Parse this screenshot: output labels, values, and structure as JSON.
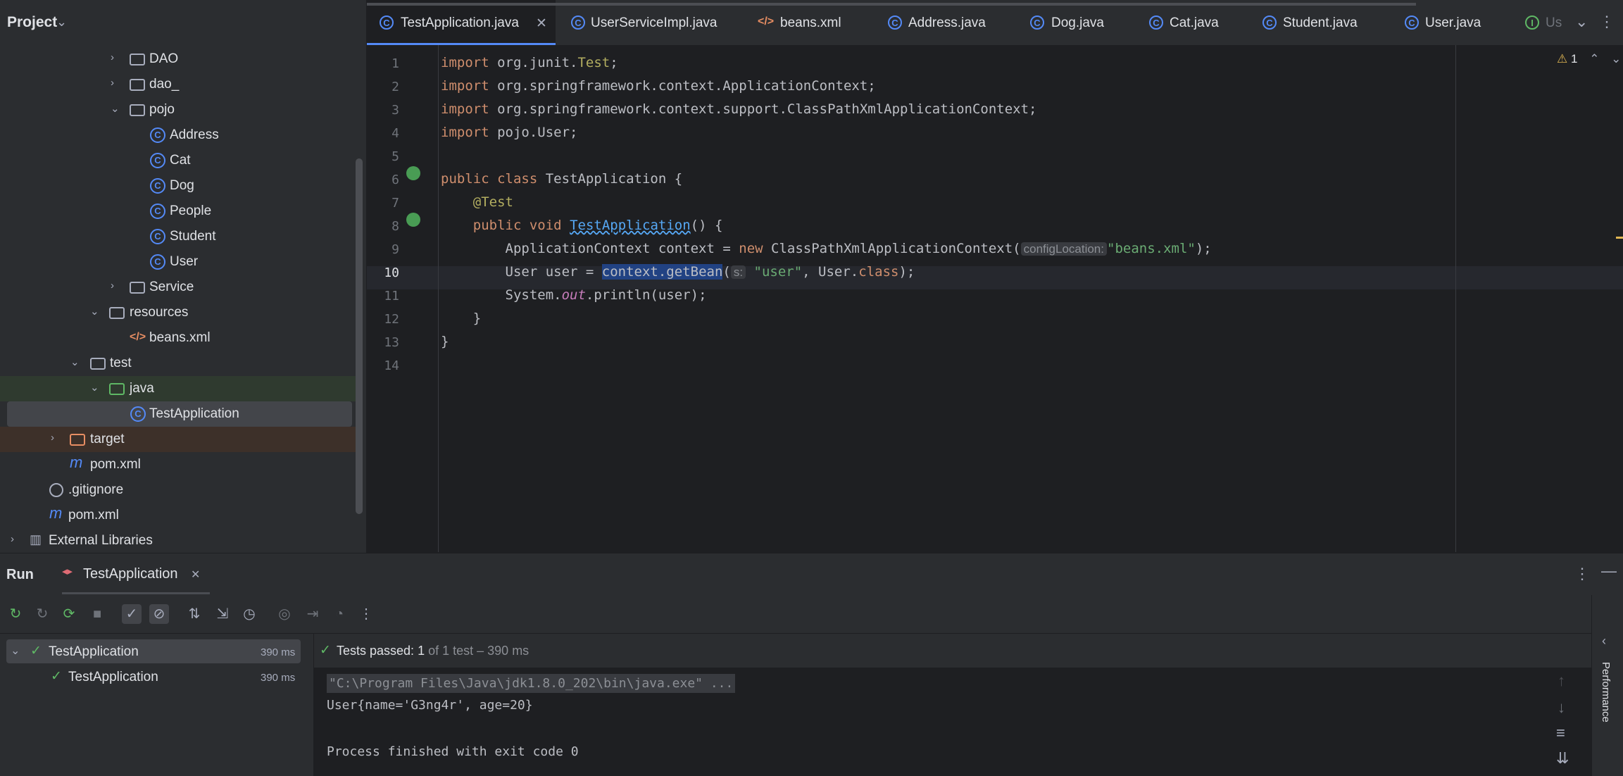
{
  "project": {
    "title": "Project",
    "tree": [
      {
        "label": "DAO",
        "kind": "folder",
        "arrow": "›"
      },
      {
        "label": "dao_",
        "kind": "folder",
        "arrow": "›"
      },
      {
        "label": "pojo",
        "kind": "folder",
        "arrow": "⌄"
      },
      {
        "label": "Address",
        "kind": "class"
      },
      {
        "label": "Cat",
        "kind": "class"
      },
      {
        "label": "Dog",
        "kind": "class"
      },
      {
        "label": "People",
        "kind": "class"
      },
      {
        "label": "Student",
        "kind": "class"
      },
      {
        "label": "User",
        "kind": "class"
      },
      {
        "label": "Service",
        "kind": "folder",
        "arrow": "›"
      },
      {
        "label": "resources",
        "kind": "folder",
        "arrow": "⌄"
      },
      {
        "label": "beans.xml",
        "kind": "xml"
      },
      {
        "label": "test",
        "kind": "folder",
        "arrow": "⌄"
      },
      {
        "label": "java",
        "kind": "folder",
        "arrow": "⌄"
      },
      {
        "label": "TestApplication",
        "kind": "class"
      },
      {
        "label": "target",
        "kind": "folder",
        "arrow": "›"
      },
      {
        "label": "pom.xml",
        "kind": "maven"
      },
      {
        "label": ".gitignore",
        "kind": "ignore"
      },
      {
        "label": "pom.xml",
        "kind": "maven"
      },
      {
        "label": "External Libraries",
        "kind": "lib",
        "arrow": "›"
      }
    ]
  },
  "tabs": [
    {
      "label": "TestApplication.java",
      "icon": "class-icon"
    },
    {
      "label": "UserServiceImpl.java",
      "icon": "class-icon"
    },
    {
      "label": "beans.xml",
      "icon": "xml-icon"
    },
    {
      "label": "Address.java",
      "icon": "class-icon"
    },
    {
      "label": "Dog.java",
      "icon": "class-icon"
    },
    {
      "label": "Cat.java",
      "icon": "class-icon"
    },
    {
      "label": "Student.java",
      "icon": "class-icon"
    },
    {
      "label": "User.java",
      "icon": "class-icon"
    },
    {
      "label": "Us",
      "icon": "interface-icon"
    }
  ],
  "editor": {
    "warning_count": "1",
    "line_numbers": [
      "1",
      "2",
      "3",
      "4",
      "5",
      "6",
      "7",
      "8",
      "9",
      "10",
      "11",
      "12",
      "13",
      "14"
    ],
    "lines": {
      "l1": {
        "kw": "import",
        "rest": " org.junit.",
        "ann": "Test",
        "end": ";"
      },
      "l2": {
        "kw": "import",
        "rest": " org.springframework.context.ApplicationContext;"
      },
      "l3": {
        "kw": "import",
        "rest": " org.springframework.context.support.ClassPathXmlApplicationContext;"
      },
      "l4": {
        "kw": "import",
        "rest": " pojo.User;"
      },
      "l6": {
        "kw": "public class",
        "rest": " TestApplication {"
      },
      "l7": {
        "ann": "@Test"
      },
      "l8": {
        "kw": "public void",
        "fn": "TestApplication",
        "rest": "() {"
      },
      "l9": {
        "a": "ApplicationContext context = ",
        "kw": "new",
        "b": " ClassPathXmlApplicationContext(",
        "hint": "configLocation:",
        "str": "\"beans.xml\"",
        "end": ");"
      },
      "l10": {
        "a": "User user = ",
        "sel": "context.getBean",
        "b": "(",
        "hint": "s:",
        "str": "\"user\"",
        "c": ", User.",
        "kw": "class",
        "end": ");"
      },
      "l11": {
        "a": "System.",
        "field": "out",
        "b": ".println(user);"
      },
      "l12": {
        "a": "}"
      },
      "l13": {
        "a": "}"
      }
    }
  },
  "run": {
    "title": "Run",
    "tab_label": "TestApplication",
    "tests": [
      {
        "label": "TestApplication",
        "time": "390 ms"
      },
      {
        "label": "TestApplication",
        "time": "390 ms"
      }
    ],
    "status_prefix": "Tests passed:",
    "status_count": "1",
    "status_suffix": "of 1 test – 390 ms",
    "console": [
      "\"C:\\Program Files\\Java\\jdk1.8.0_202\\bin\\java.exe\" ...",
      "User{name='G3ng4r', age=20}",
      "",
      "Process finished with exit code 0"
    ],
    "side_label": "Performance"
  }
}
